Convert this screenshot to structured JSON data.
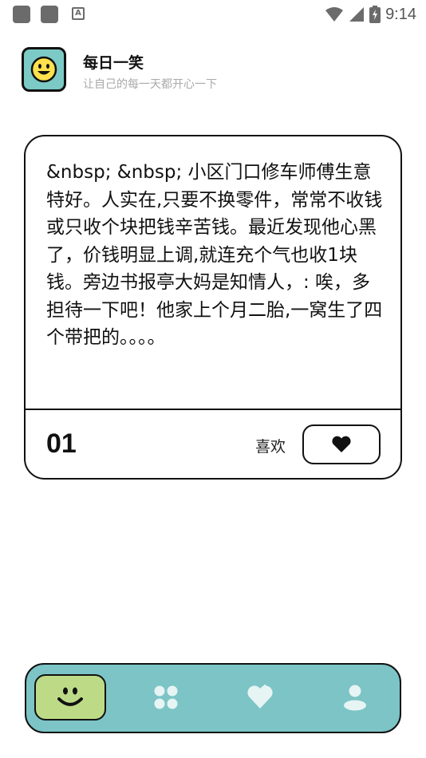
{
  "status_bar": {
    "time": "9:14",
    "icons": [
      "app-notification-icon",
      "app-notification-icon",
      "accessibility-a-icon",
      "wifi-icon",
      "cellular-signal-icon",
      "battery-charging-icon"
    ]
  },
  "header": {
    "title": "每日一笑",
    "subtitle": "让自己的每一天都开心一下",
    "logo_icon": "smiley-face-icon"
  },
  "joke_card": {
    "text": "&nbsp; &nbsp; 小区门口修车师傅生意特好。人实在,只要不换零件，常常不收钱或只收个块把钱辛苦钱。最近发现他心黑了，价钱明显上调,就连充个气也收1块钱。旁边书报亭大妈是知情人，: 唉，多担待一下吧！他家上个月二胎,一窝生了四个带把的。。。。",
    "number": "01",
    "like_label": "喜欢",
    "like_icon": "heart-icon"
  },
  "bottom_nav": {
    "items": [
      {
        "icon": "smiley-icon",
        "active": true
      },
      {
        "icon": "grid-icon",
        "active": false
      },
      {
        "icon": "heart-icon",
        "active": false
      },
      {
        "icon": "user-icon",
        "active": false
      }
    ]
  },
  "colors": {
    "accent_teal": "#7ccac6",
    "nav_active_green": "#bddb87",
    "outline": "#111111"
  }
}
